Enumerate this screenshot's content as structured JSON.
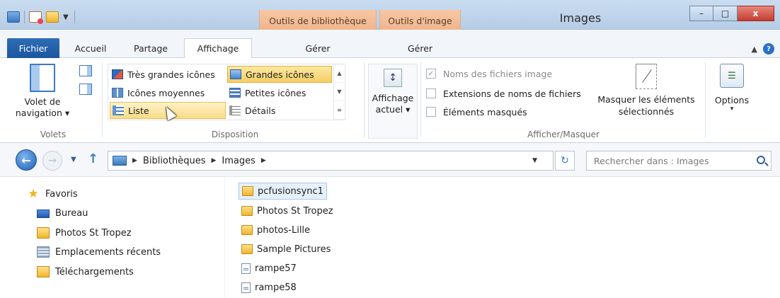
{
  "window": {
    "title": "Images",
    "buttons": {
      "minimize": "–",
      "maximize": "□",
      "close": "x"
    }
  },
  "context_tabs": {
    "library_tools": "Outils de bibliothèque",
    "image_tools": "Outils d'image"
  },
  "ribbon_tabs": {
    "fichier": "Fichier",
    "accueil": "Accueil",
    "partage": "Partage",
    "affichage": "Affichage",
    "gerer_lib": "Gérer",
    "gerer_img": "Gérer",
    "active": "Affichage"
  },
  "ribbon": {
    "volets": {
      "nav_pane_line1": "Volet de",
      "nav_pane_line2": "navigation ▾",
      "group_label": "Volets"
    },
    "disposition": {
      "items": {
        "tres_grandes": "Très grandes icônes",
        "grandes": "Grandes icônes",
        "moyennes": "Icônes moyennes",
        "petites": "Petites icônes",
        "liste": "Liste",
        "details": "Détails"
      },
      "selected": "Grandes icônes",
      "hovered": "Liste",
      "group_label": "Disposition"
    },
    "current_view": {
      "line1": "Affichage",
      "line2": "actuel ▾"
    },
    "show_hide": {
      "file_name_ext_disabled": "Noms des fichiers image",
      "file_ext": "Extensions de noms de fichiers",
      "hidden_items": "Éléments masqués",
      "hide_selected_line1": "Masquer les éléments",
      "hide_selected_line2": "sélectionnés",
      "group_label": "Afficher/Masquer"
    },
    "options": {
      "label": "Options",
      "arrow": "▾"
    }
  },
  "address_bar": {
    "crumbs": [
      "Bibliothèques",
      "Images"
    ],
    "search_placeholder": "Rechercher dans : Images"
  },
  "nav_pane": {
    "favorites": "Favoris",
    "bureau": "Bureau",
    "photos_st_tropez": "Photos St Tropez",
    "emplacements": "Emplacements récents",
    "telechargements": "Téléchargements"
  },
  "files": [
    {
      "name": "pcfusionsync1",
      "type": "folder",
      "selected": true
    },
    {
      "name": "Photos St Tropez",
      "type": "folder"
    },
    {
      "name": "photos-Lille",
      "type": "folder"
    },
    {
      "name": "Sample Pictures",
      "type": "folder"
    },
    {
      "name": "rampe57",
      "type": "file"
    },
    {
      "name": "rampe58",
      "type": "file"
    }
  ],
  "colors": {
    "ribbon_file_tab": "#1b56a0",
    "context_tab": "#efb48c",
    "selection_yellow": "#f5cd64",
    "selected_row": "#e6f0fb"
  }
}
